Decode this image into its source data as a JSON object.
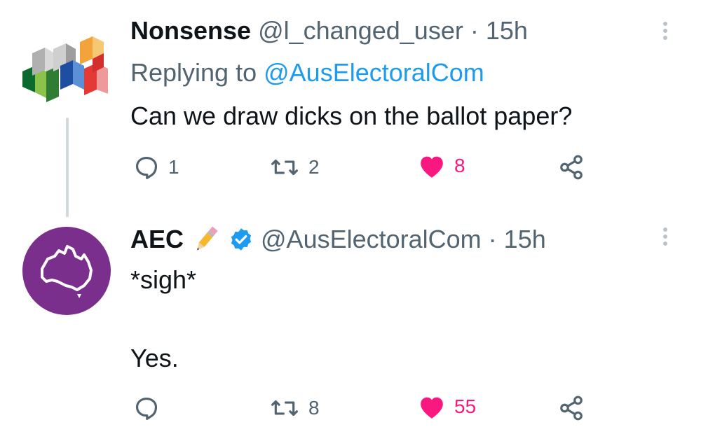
{
  "colors": {
    "accent": "#1d9bf0",
    "like": "#f91880",
    "muted": "#536471",
    "text": "#0f1419",
    "aec_purple": "#7a2f8c"
  },
  "tweet1": {
    "name": "Nonsense",
    "handle": "@l_changed_user",
    "sep": "·",
    "time": "15h",
    "replying_prefix": "Replying to",
    "replying_handle": "@AusElectoralCom",
    "text": "Can we draw dicks on the ballot paper?",
    "replies": "1",
    "retweets": "2",
    "likes": "8",
    "liked": true
  },
  "tweet2": {
    "name": "AEC",
    "name_emoji": "pencil",
    "verified": true,
    "handle": "@AusElectoralCom",
    "sep": "·",
    "time": "15h",
    "text_line1": "*sigh*",
    "text_line2": "Yes.",
    "replies": "",
    "retweets": "8",
    "likes": "55",
    "liked": true
  },
  "icons": [
    "reply-icon",
    "retweet-icon",
    "heart-icon",
    "share-icon",
    "more-icon",
    "verified-badge-icon",
    "pencil-emoji-icon"
  ]
}
